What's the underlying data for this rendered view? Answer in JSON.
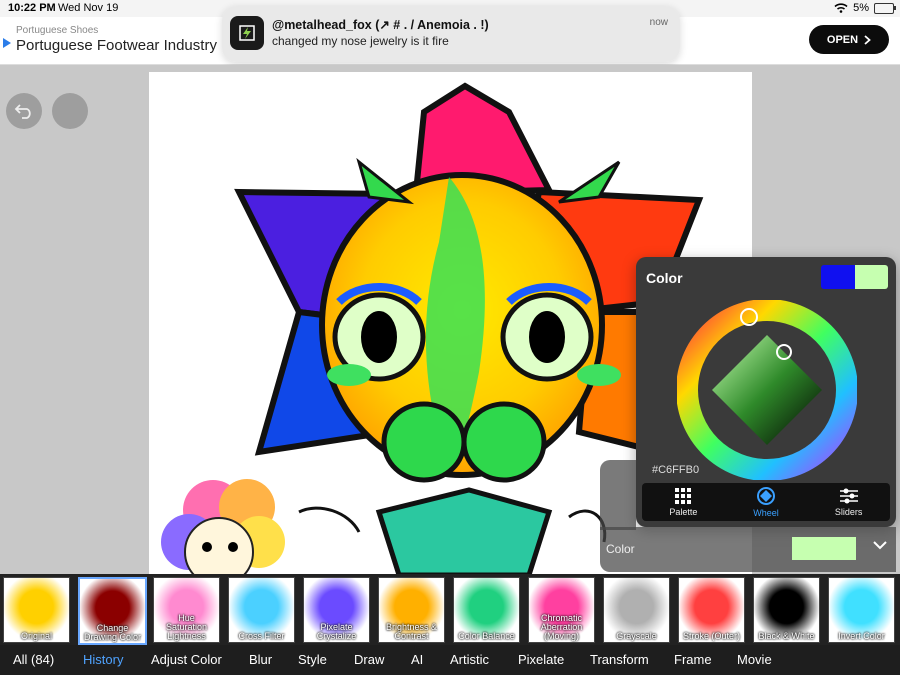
{
  "status_bar": {
    "time": "10:22 PM",
    "date": "Wed Nov 19",
    "battery": "5%"
  },
  "ad": {
    "sponsor": "Portuguese Shoes",
    "title": "Portuguese Footwear Industry",
    "open_label": "OPEN"
  },
  "notification": {
    "title": "@metalhead_fox (↗ # . / Anemoia . !)",
    "body": "changed my nose jewelry is it fire",
    "time": "now"
  },
  "color_panel": {
    "title": "Color",
    "hex": "#C6FFB0",
    "tabs": [
      {
        "label": "Palette",
        "icon": "grid-icon"
      },
      {
        "label": "Wheel",
        "icon": "wheel-icon"
      },
      {
        "label": "Sliders",
        "icon": "sliders-icon"
      }
    ],
    "active_tab": "Wheel",
    "swatch_primary": "#1010f0",
    "swatch_secondary": "#c6ffb0"
  },
  "color_row": {
    "label": "Color",
    "value": "#c6ffb0"
  },
  "filters": [
    {
      "label": "Original"
    },
    {
      "label": "Change\nDrawing Color"
    },
    {
      "label": "Hue\nSaturation\nLightness"
    },
    {
      "label": "Cross Filter"
    },
    {
      "label": "Pixelate\nCrystalize"
    },
    {
      "label": "Brightness &\nContrast"
    },
    {
      "label": "Color Balance"
    },
    {
      "label": "Chromatic\nAberration\n(Moving)"
    },
    {
      "label": "Grayscale"
    },
    {
      "label": "Stroke (Outer)"
    },
    {
      "label": "Black & White"
    },
    {
      "label": "Invert Color"
    }
  ],
  "selected_filter": "Change\nDrawing Color",
  "categories": [
    {
      "label": "All (84)"
    },
    {
      "label": "History"
    },
    {
      "label": "Adjust Color"
    },
    {
      "label": "Blur"
    },
    {
      "label": "Style"
    },
    {
      "label": "Draw"
    },
    {
      "label": "AI"
    },
    {
      "label": "Artistic"
    },
    {
      "label": "Pixelate"
    },
    {
      "label": "Transform"
    },
    {
      "label": "Frame"
    },
    {
      "label": "Movie"
    }
  ],
  "active_category": "History"
}
